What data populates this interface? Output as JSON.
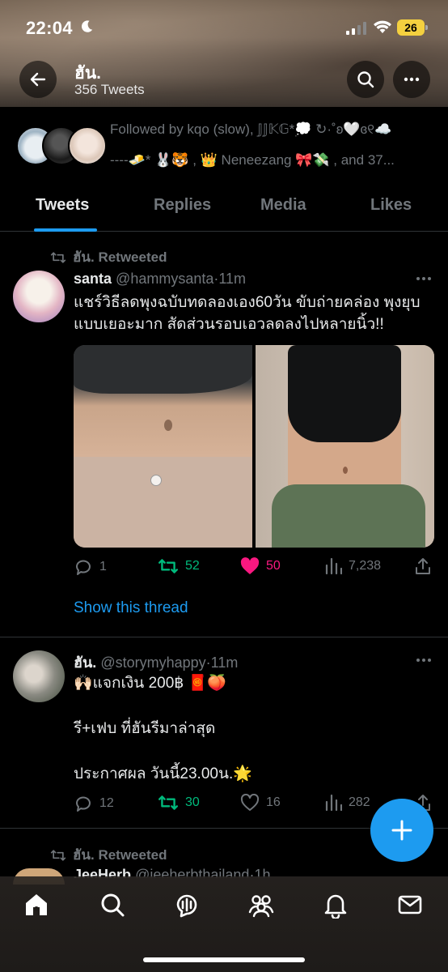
{
  "status": {
    "time": "22:04",
    "battery": "26"
  },
  "header": {
    "title": "ฮัน.",
    "tweet_count": "356 Tweets"
  },
  "followed_by": {
    "line1": "Followed by kqo (slow), 𝕁𝕁𝕂𝔾*💭 ↻·˚ʚ🤍ɞ୧☁️",
    "line2": "----🧈* 🐰🐯 , 👑 Neneezang 🎀💸 , and 37..."
  },
  "tabs": [
    {
      "label": "Tweets",
      "active": true
    },
    {
      "label": "Replies",
      "active": false
    },
    {
      "label": "Media",
      "active": false
    },
    {
      "label": "Likes",
      "active": false
    }
  ],
  "tweets": [
    {
      "retweeted_by": "ฮัน. Retweeted",
      "name": "santa",
      "handle": "@hammysanta",
      "time": "11m",
      "text": "แชร์วิธีลดพุงฉบับทดลองเอง60วัน ขับถ่ายคล่อง พุงยุบแบบเยอะมาก สัดส่วนรอบเอวลดลงไปหลายนิ้ว!!",
      "replies": "1",
      "retweets": "52",
      "likes": "50",
      "views": "7,238",
      "show_thread": "Show this thread"
    },
    {
      "name": "ฮัน.",
      "handle": "@storymyhappy",
      "time": "11m",
      "line1": "🙌🏻แจกเงิน 200฿ 🧧🍑",
      "line2": "รี+เฟบ ที่ฮันรีมาล่าสุด",
      "line3": "ประกาศผล วันนี้23.00น.🌟",
      "replies": "12",
      "retweets": "30",
      "likes": "16",
      "views": "282"
    },
    {
      "retweeted_by": "ฮัน. Retweeted",
      "name": "JeeHerb",
      "handle": "@jeeherbthailand",
      "time": "1h"
    }
  ],
  "colors": {
    "accent": "#1d9bf0",
    "retweet": "#00ba7c",
    "like": "#f91880",
    "muted": "#71767b"
  }
}
